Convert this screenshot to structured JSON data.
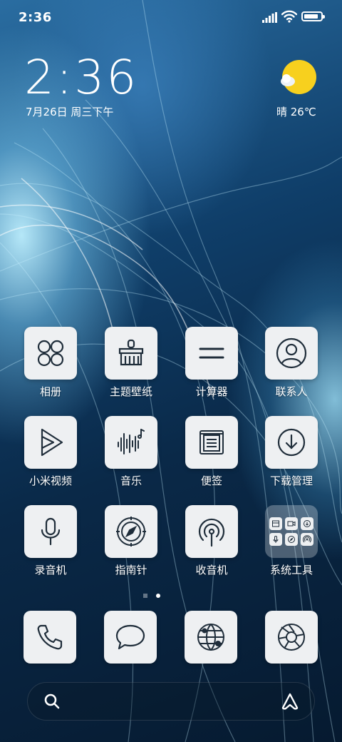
{
  "status_bar": {
    "time": "2:36",
    "battery_level": 0.85
  },
  "clock_widget": {
    "time": "2:36",
    "date": "7月26日 周三下午"
  },
  "weather_widget": {
    "text": "晴 26℃",
    "icon": "sunny-cloud-icon"
  },
  "apps": [
    {
      "label": "相册",
      "icon": "gallery-icon"
    },
    {
      "label": "主题壁纸",
      "icon": "theme-brush-icon"
    },
    {
      "label": "计算器",
      "icon": "calculator-icon"
    },
    {
      "label": "联系人",
      "icon": "contacts-icon"
    },
    {
      "label": "小米视频",
      "icon": "video-play-icon"
    },
    {
      "label": "音乐",
      "icon": "music-icon"
    },
    {
      "label": "便签",
      "icon": "notes-icon"
    },
    {
      "label": "下载管理",
      "icon": "download-icon"
    },
    {
      "label": "录音机",
      "icon": "microphone-icon"
    },
    {
      "label": "指南针",
      "icon": "compass-icon"
    },
    {
      "label": "收音机",
      "icon": "radio-icon"
    },
    {
      "label": "系统工具",
      "icon": "folder-icon"
    }
  ],
  "dock": [
    {
      "icon": "phone-icon"
    },
    {
      "icon": "messages-icon"
    },
    {
      "icon": "browser-icon"
    },
    {
      "icon": "camera-icon"
    }
  ],
  "pager": {
    "pages": 2,
    "current": 2
  },
  "colors": {
    "tile_bg": "#eef0f2",
    "icon_stroke": "#1f2d3a",
    "sun": "#f7d01e"
  }
}
